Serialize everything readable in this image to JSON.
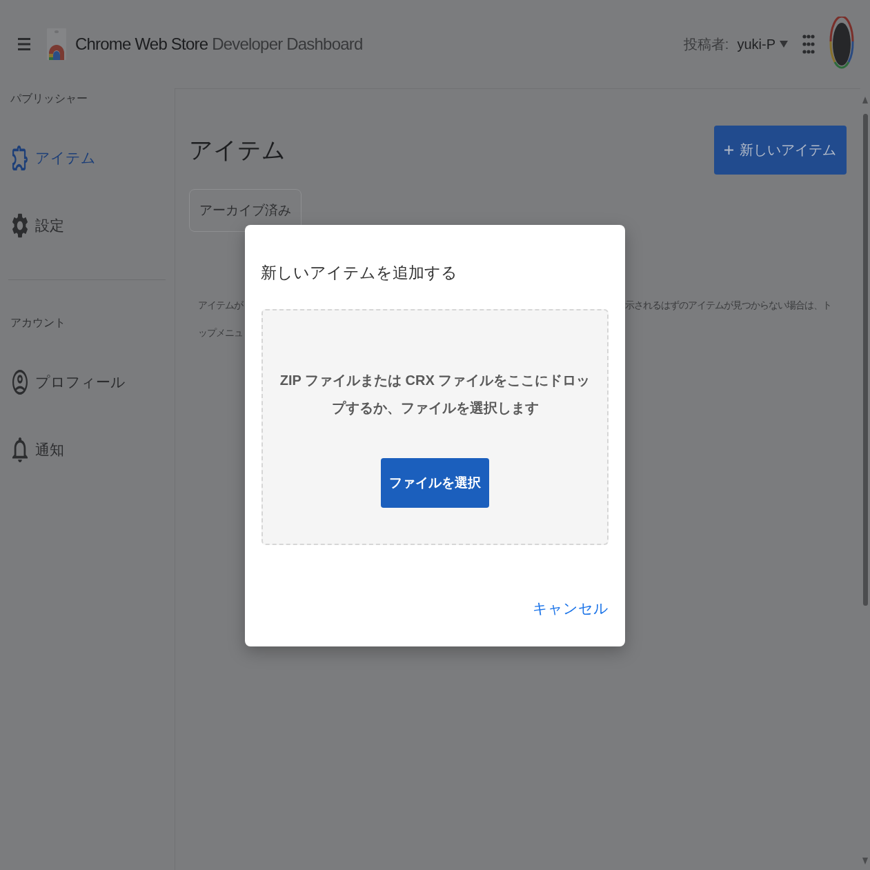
{
  "header": {
    "title_primary": "Chrome Web Store",
    "title_secondary": "Developer Dashboard",
    "publisher_label": "投稿者:",
    "publisher_name": "yuki-P"
  },
  "sidebar": {
    "sections": [
      {
        "heading": "パブリッシャー",
        "items": [
          {
            "label": "アイテム",
            "selected": true
          },
          {
            "label": "設定",
            "selected": false
          }
        ]
      },
      {
        "heading": "アカウント",
        "items": [
          {
            "label": "プロフィール",
            "selected": false
          },
          {
            "label": "通知",
            "selected": false
          }
        ]
      }
    ]
  },
  "main": {
    "heading": "アイテム",
    "new_button": "新しいアイテム",
    "filter_button": "アーカイブ済み",
    "description_lines": [
      {
        "left": "アイテムが",
        "right": "示されるはずのアイテムが見つからない場合は、ト"
      },
      {
        "left": "ップメニュ"
      }
    ]
  },
  "dialog": {
    "title": "新しいアイテムを追加する",
    "drop_text": "ZIP ファイルまたは CRX ファイルをここにドロップするか、ファイルを選択します",
    "choose_button": "ファイルを選択",
    "cancel_button": "キャンセル"
  }
}
